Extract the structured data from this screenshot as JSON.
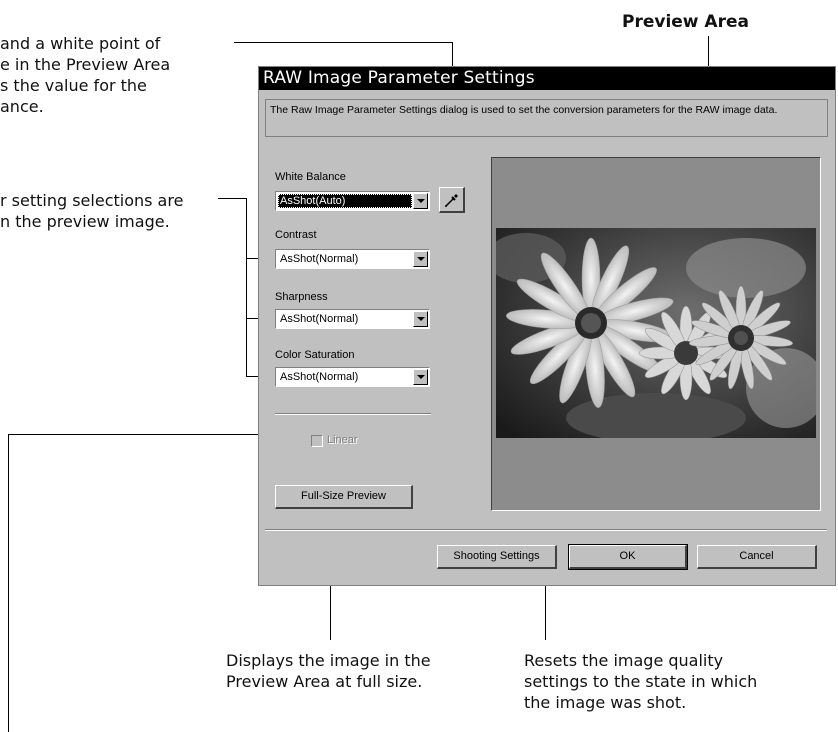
{
  "annotations": {
    "preview_area_label": "Preview Area",
    "top_left_note": "and a white point of\ne in the Preview Area\ns the value for the\nance.",
    "mid_left_note": "r setting selections are\nn the preview image.",
    "full_size_note": "Displays the image in the\nPreview Area at full size.",
    "shooting_settings_note": "Resets the image quality\nsettings to the state in which\nthe image was shot."
  },
  "dialog": {
    "title": "RAW Image Parameter Settings",
    "description": "The Raw Image Parameter Settings dialog is used to set the conversion parameters for the RAW image data.",
    "fields": {
      "white_balance": {
        "label": "White Balance",
        "value": "AsShot(Auto)"
      },
      "contrast": {
        "label": "Contrast",
        "value": "AsShot(Normal)"
      },
      "sharpness": {
        "label": "Sharpness",
        "value": "AsShot(Normal)"
      },
      "color_saturation": {
        "label": "Color Saturation",
        "value": "AsShot(Normal)"
      }
    },
    "linear_label": "Linear",
    "full_size_preview_label": "Full-Size Preview",
    "shooting_settings_label": "Shooting Settings",
    "ok_label": "OK",
    "cancel_label": "Cancel",
    "eyedropper_icon": "eyedropper-icon"
  }
}
